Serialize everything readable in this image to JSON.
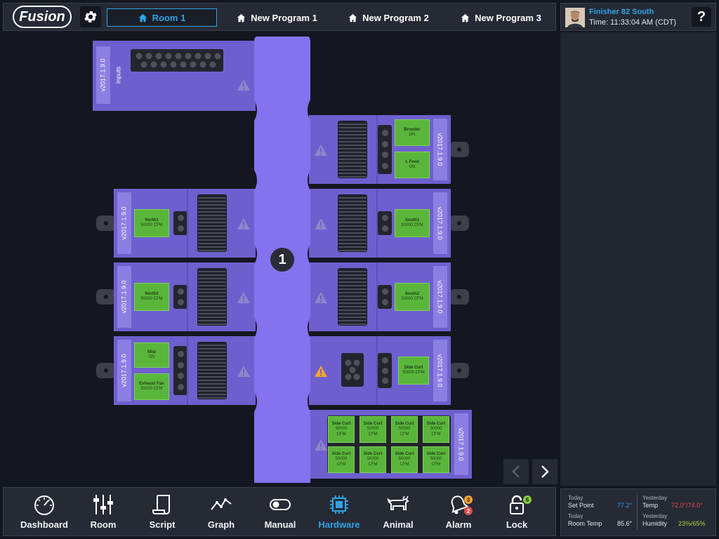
{
  "header": {
    "logo": "Fusion",
    "tabs": [
      {
        "label": "Room 1",
        "active": true
      },
      {
        "label": "New Program 1"
      },
      {
        "label": "New Program 2"
      },
      {
        "label": "New Program 3"
      }
    ]
  },
  "user": {
    "name": "Finisher 82 South",
    "time": "Time: 11:33:04 AM (CDT)",
    "help_label": "?"
  },
  "hardware": {
    "tower_label": "1",
    "version": "v2017.1.9.0",
    "inputs_label": "Inputs",
    "relays": {
      "brooder": [
        "Brooder",
        "ON"
      ],
      "lfeed": [
        "L Feed",
        "ON"
      ],
      "north1": [
        "North1",
        "50000 CFM"
      ],
      "south1": [
        "South1",
        "50000 CFM"
      ],
      "north2": [
        "North2",
        "50000 CFM"
      ],
      "south2": [
        "South2",
        "50000 CFM"
      ],
      "mist": [
        "Mist",
        "ON"
      ],
      "exhaust": [
        "Exhaust Fan",
        "50000 CFM"
      ],
      "sidecurt": [
        "Side Curt",
        "50000 CFM"
      ],
      "grid_name": "Side Curt",
      "grid_val1": "50000",
      "grid_val2": "CFM"
    }
  },
  "nav": {
    "items": [
      {
        "label": "Dashboard"
      },
      {
        "label": "Room"
      },
      {
        "label": "Script"
      },
      {
        "label": "Graph"
      },
      {
        "label": "Manual"
      },
      {
        "label": "Hardware",
        "active": true
      },
      {
        "label": "Animal"
      },
      {
        "label": "Alarm",
        "badge_top": "3",
        "badge_bottom": "2"
      },
      {
        "label": "Lock",
        "badge": "6"
      }
    ]
  },
  "weather": {
    "today1": "Today",
    "setpoint_label": "Set Point",
    "setpoint_value": "77.2°",
    "today2": "Today",
    "roomtemp_label": "Room Temp",
    "roomtemp_value": "85.6°",
    "yesterday1": "Yesterday",
    "temp_label": "Temp",
    "temp_value": "72.0°/74.0°",
    "yesterday2": "Yesterday",
    "humidity_label": "Humidity",
    "humidity_value": "23%/65%"
  },
  "colors": {
    "accent": "#2fa3e6",
    "board": "#6e5fcf",
    "tower": "#8472ee",
    "relay": "#5ab63b",
    "warning": "#f4a42a",
    "temp_red": "#e84a4a",
    "humidity_green": "#a9d63b"
  }
}
